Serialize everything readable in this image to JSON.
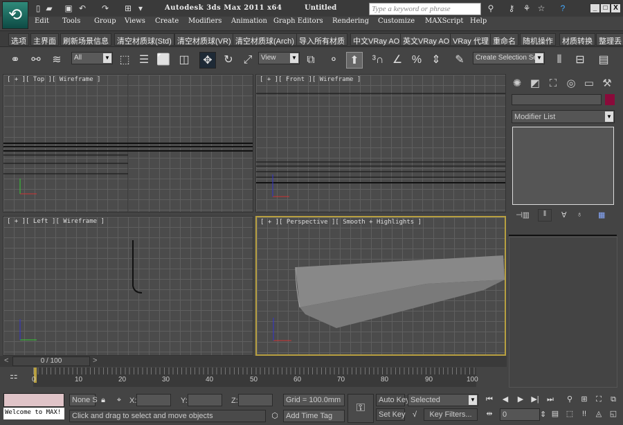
{
  "window": {
    "title": "Autodesk 3ds Max  2011 x64",
    "document": "Untitled",
    "search_placeholder": "Type a keyword or phrase",
    "minimize": "_",
    "maximize": "□",
    "close": "X"
  },
  "menu": [
    "Edit",
    "Tools",
    "Group",
    "Views",
    "Create",
    "Modifiers",
    "Animation",
    "Graph Editors",
    "Rendering",
    "Customize",
    "MAXScript",
    "Help"
  ],
  "custom_toolbar": [
    "选项",
    "主界面",
    "刷新场景信息",
    "清空材质球(Std)",
    "清空材质球(VR)",
    "清空材质球(Arch)",
    "导入所有材质",
    "中文VRay AO",
    "英文VRay AO",
    "VRay 代理",
    "重命名",
    "随机操作",
    "材质转换",
    "整理丢"
  ],
  "toolbar": {
    "selection_filter": "All",
    "reference_coord": "View",
    "selection_set": "Create Selection Se"
  },
  "viewports": [
    {
      "label": "[ + ][ Top ][ Wireframe ]"
    },
    {
      "label": "[ + ][ Front ][ Wireframe ]"
    },
    {
      "label": "[ + ][ Left ][ Wireframe ]"
    },
    {
      "label": "[ + ][ Perspective ][ Smooth + Highlights ]",
      "active": true
    }
  ],
  "command_panel": {
    "modifier_list": "Modifier List",
    "object_color": "#8a0a3a"
  },
  "timeline": {
    "frame_display": "0 / 100",
    "ticks": [
      "0",
      "10",
      "20",
      "30",
      "40",
      "50",
      "60",
      "70",
      "80",
      "90",
      "100"
    ]
  },
  "status": {
    "welcome": "Welcome to MAX!",
    "selection": "None S",
    "x_label": "X:",
    "y_label": "Y:",
    "z_label": "Z:",
    "grid": "Grid = 100.0mm",
    "prompt": "Click and drag to select and move objects",
    "add_time_tag": "Add Time Tag",
    "auto_key": "Auto Key",
    "set_key": "Set Key",
    "key_mode": "Selected",
    "key_filters": "Key Filters...",
    "current_frame": "0"
  },
  "colors": {
    "accent_active_viewport": "#b8a040",
    "background": "#444444"
  }
}
